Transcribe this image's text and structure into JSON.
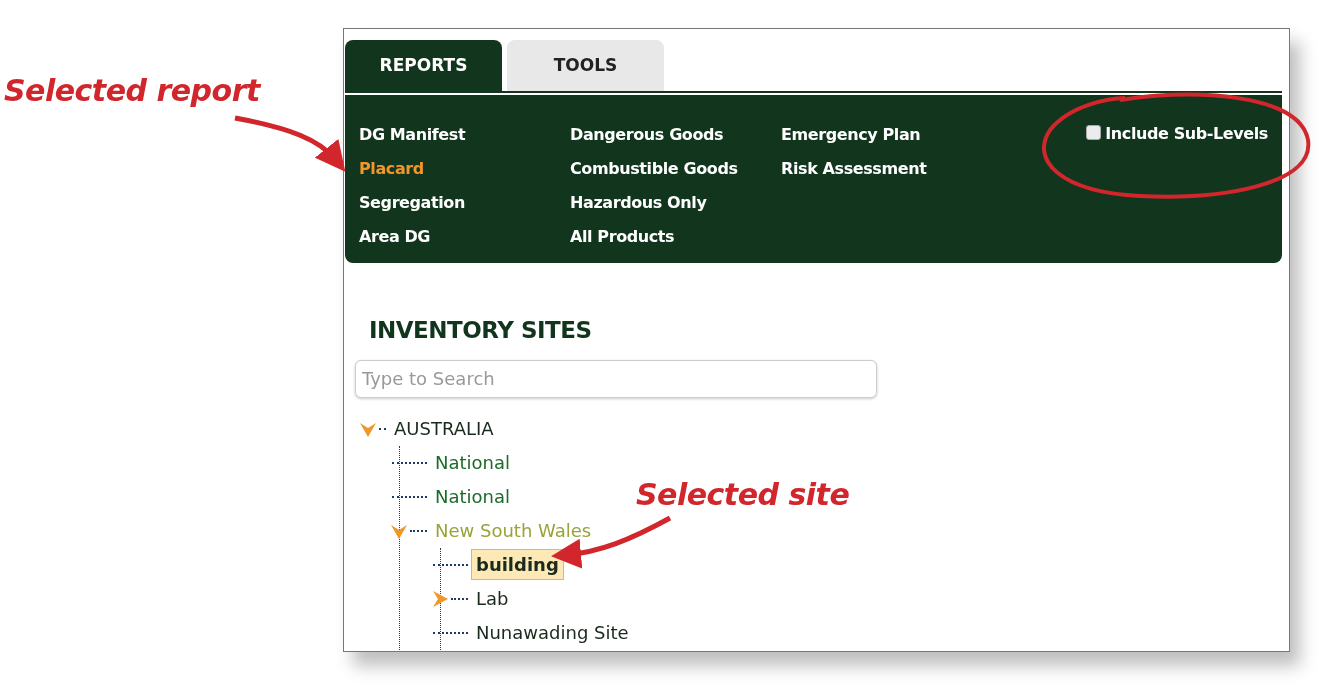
{
  "annotations": [
    {
      "text": "Selected report"
    },
    {
      "text": "Selected site"
    }
  ],
  "tabs": [
    {
      "label": "REPORTS",
      "selected": true
    },
    {
      "label": "TOOLS",
      "selected": false
    }
  ],
  "reports": {
    "columns": [
      [
        {
          "label": "DG Manifest",
          "selected": false
        },
        {
          "label": "Placard",
          "selected": true
        },
        {
          "label": "Segregation",
          "selected": false
        },
        {
          "label": "Area DG",
          "selected": false
        }
      ],
      [
        {
          "label": "Dangerous Goods",
          "selected": false
        },
        {
          "label": "Combustible Goods",
          "selected": false
        },
        {
          "label": "Hazardous Only",
          "selected": false
        },
        {
          "label": "All Products",
          "selected": false
        }
      ],
      [
        {
          "label": "Emergency Plan",
          "selected": false
        },
        {
          "label": "Risk Assessment",
          "selected": false
        }
      ]
    ]
  },
  "include_sub_levels": {
    "label": "Include Sub-Levels",
    "checked": false
  },
  "sites": {
    "title": "INVENTORY SITES",
    "search": {
      "placeholder": "Type to Search"
    },
    "tree": [
      {
        "label": "AUSTRALIA",
        "color": "#1b2a1e",
        "expanded": true,
        "selected": false,
        "children": [
          {
            "label": "National",
            "color": "#1d6a2c",
            "selected": false
          },
          {
            "label": "National",
            "color": "#1d6a2c",
            "selected": false
          },
          {
            "label": "New South Wales",
            "color": "#9aa33a",
            "expanded": true,
            "selected": false,
            "children": [
              {
                "label": "building",
                "color": "#1b2a1e",
                "selected": true
              },
              {
                "label": "Lab",
                "color": "#1b2a1e",
                "expanded": false,
                "selected": false
              },
              {
                "label": "Nunawading Site",
                "color": "#1b2a1e",
                "selected": false
              }
            ]
          }
        ]
      }
    ]
  }
}
